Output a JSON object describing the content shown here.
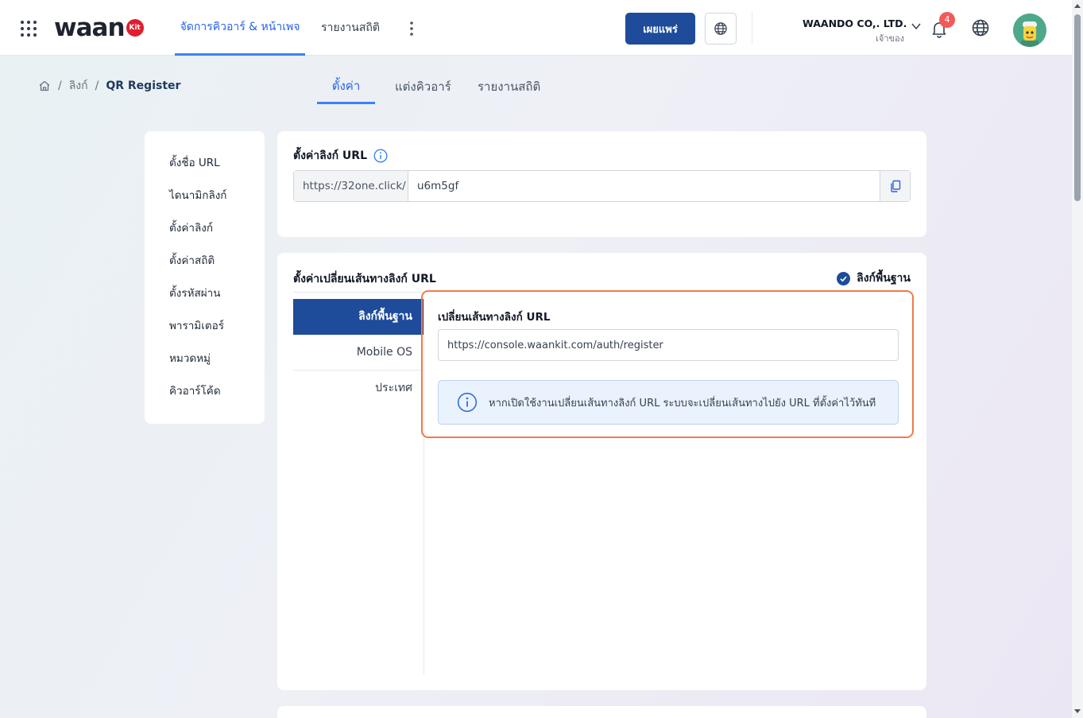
{
  "header": {
    "logo_text": "waan",
    "logo_badge": "Kit",
    "nav_tabs": [
      {
        "label": "จัดการคิวอาร์ & หน้าเพจ",
        "active": true
      },
      {
        "label": "รายงานสถิติ",
        "active": false
      }
    ],
    "publish_label": "เผยแพร่",
    "company_name": "WAANDO CO,. LTD.",
    "company_role": "เจ้าของ",
    "notification_count": "4"
  },
  "breadcrumb": {
    "items": [
      "ลิงก์"
    ],
    "current": "QR Register"
  },
  "subtabs": [
    {
      "label": "ตั้งค่า",
      "active": true
    },
    {
      "label": "แต่งคิวอาร์",
      "active": false
    },
    {
      "label": "รายงานสถิติ",
      "active": false
    }
  ],
  "leftmenu": {
    "items": [
      "ตั้งชื่อ URL",
      "ไดนามิกลิงก์",
      "ตั้งค่าลิงก์",
      "ตั้งค่าสถิติ",
      "ตั้งรหัสผ่าน",
      "พารามิเตอร์",
      "หมวดหมู่",
      "คิวอาร์โค้ด"
    ]
  },
  "link_settings": {
    "title": "ตั้งค่าลิงก์ URL",
    "prefix": "https://32one.click/",
    "slug": "u6m5gf"
  },
  "redirect_settings": {
    "title": "ตั้งค่าเปลี่ยนเส้นทางลิงก์ URL",
    "basic_label": "ลิงก์พื้นฐาน",
    "basic_checked": true,
    "tabs": [
      {
        "label": "ลิงก์พื้นฐาน",
        "active": true
      },
      {
        "label": "Mobile OS",
        "active": false
      },
      {
        "label": "ประเทศ",
        "active": false
      }
    ],
    "redirect_label": "เปลี่ยนเส้นทางลิงก์ URL",
    "redirect_url": "https://console.waankit.com/auth/register",
    "info_text": "หากเปิดใช้งานเปลี่ยนเส้นทางลิงก์ URL ระบบจะเปลี่ยนเส้นทางไปยัง URL ที่ตั้งค่าไว้ทันที"
  },
  "colors": {
    "primary": "#1e4b9a",
    "accent": "#3b82f6",
    "highlight_border": "#f07a4a",
    "badge": "#f25a5a"
  }
}
